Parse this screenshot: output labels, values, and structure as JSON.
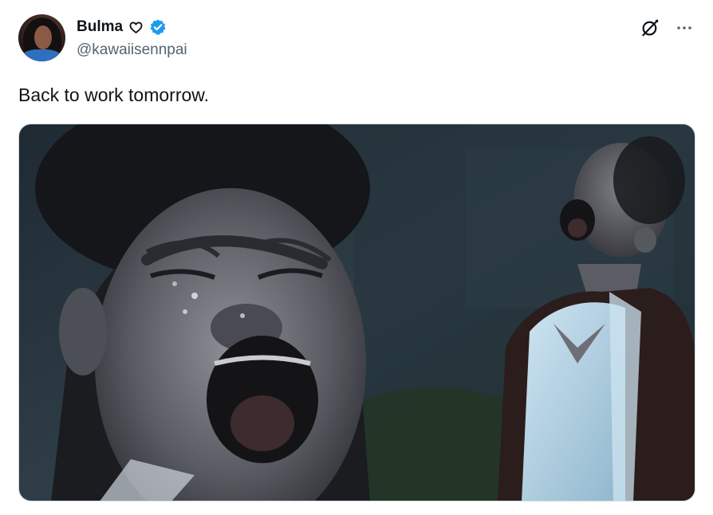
{
  "author": {
    "display_name": "Bulma",
    "handle": "@kawaiisennpai",
    "verified": true,
    "name_emoji_icon": "heart-outline-icon",
    "verified_icon": "verified-badge-icon",
    "verified_color": "#1d9bf0"
  },
  "actions": {
    "grok_icon": "grok-icon",
    "more_icon": "more-horizontal-icon"
  },
  "tweet": {
    "text": "Back to work tomorrow."
  },
  "media": {
    "type": "image",
    "accent_colors": [
      "#2b3a44",
      "#9ec4d8",
      "#3a2a26"
    ]
  },
  "colors": {
    "text_primary": "#0f1419",
    "text_secondary": "#536471",
    "background": "#ffffff"
  }
}
